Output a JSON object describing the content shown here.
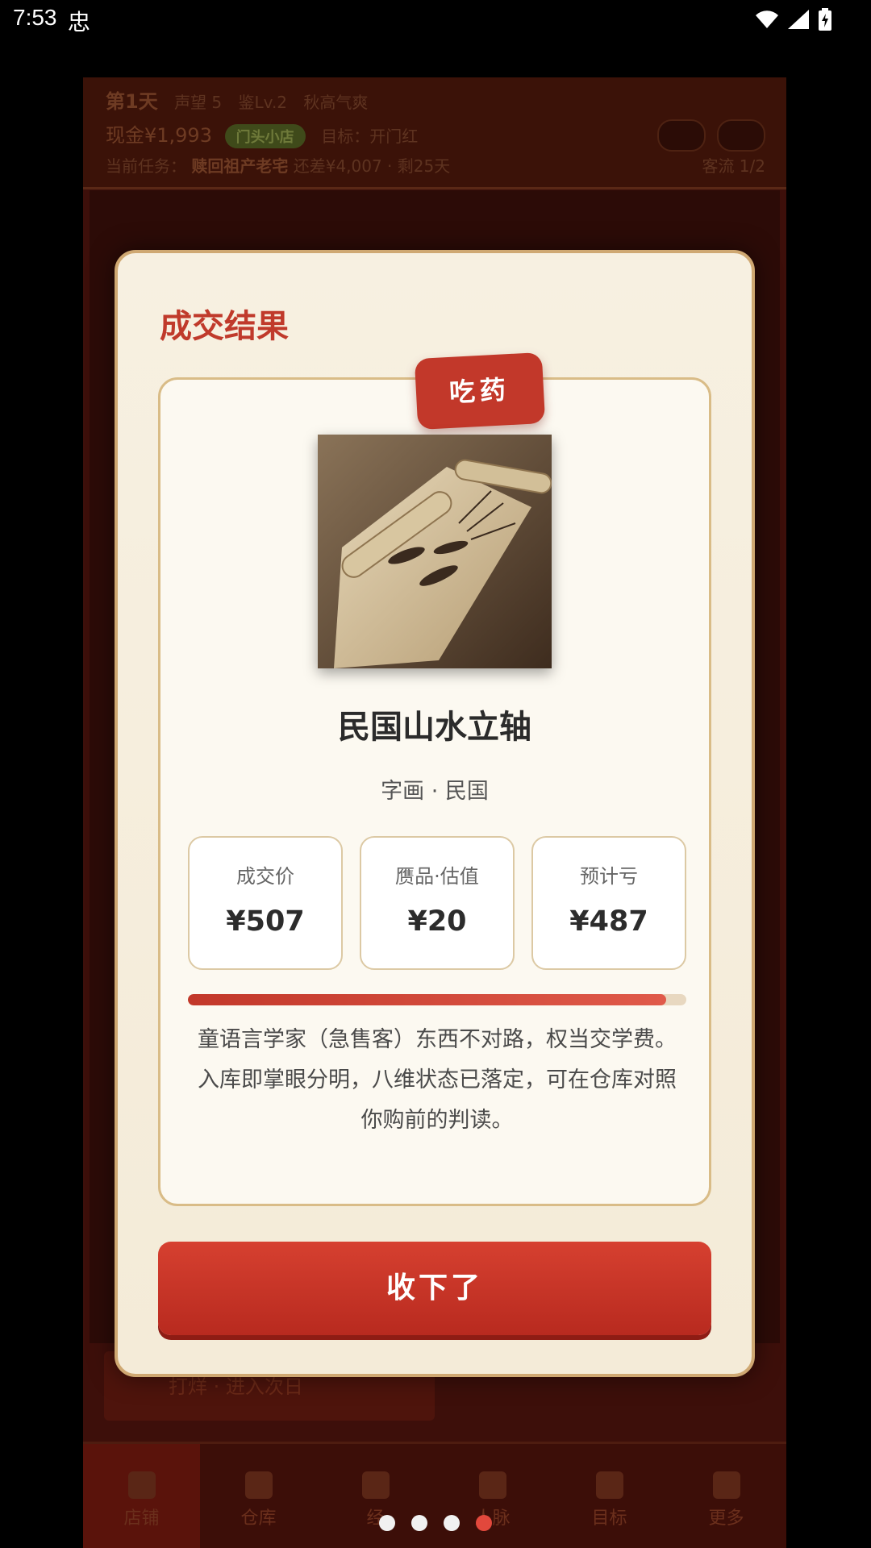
{
  "status_bar": {
    "time": "7:53",
    "bug_glyph": "忠",
    "icons": [
      "wifi-icon",
      "signal-icon",
      "battery-icon"
    ]
  },
  "app_header": {
    "day": "第1天",
    "reputation": "声望 5",
    "appraisal": "鉴Lv.2",
    "weather": "秋高气爽",
    "cash": "现金¥1,993",
    "shop_chip": "门头小店",
    "goal": "目标：开门红",
    "task_prefix": "当前任务：",
    "task_name": "赎回祖产老宅",
    "task_detail": "还差¥4,007 · 剩25天",
    "customer_flow": "客流 1/2"
  },
  "seal_button": {
    "label": "打烊 · 进入次日"
  },
  "bottom_nav": {
    "tabs": [
      {
        "label": "店铺",
        "icon": "shop-icon",
        "active": true
      },
      {
        "label": "仓库",
        "icon": "warehouse-icon",
        "active": false
      },
      {
        "label": "经",
        "icon": "ledger-icon",
        "active": false
      },
      {
        "label": "人脉",
        "icon": "people-icon",
        "active": false
      },
      {
        "label": "目标",
        "icon": "goal-icon",
        "active": false
      },
      {
        "label": "更多",
        "icon": "more-icon",
        "active": false
      }
    ]
  },
  "modal": {
    "title": "成交结果",
    "stamp": "吃药",
    "item": {
      "image": "scroll-painting-shrimp",
      "name": "民国山水立轴",
      "category": "字画 · 民国"
    },
    "stats": [
      {
        "label": "成交价",
        "value": "¥507"
      },
      {
        "label": "赝品·估值",
        "value": "¥20"
      },
      {
        "label": "预计亏",
        "value": "¥487"
      }
    ],
    "loss_ratio": 0.96,
    "description": [
      "童语言学家（急售客）东西不对路，权当交学费。",
      "入库即掌眼分明，八维状态已落定，可在仓库对照你购前的判读。"
    ],
    "confirm_button": "收下了"
  },
  "pager": {
    "count": 4,
    "active_index": 3
  },
  "colors": {
    "accent_red": "#c2382a",
    "card_bg": "#fcf9f1",
    "frame_gold": "#cfa872"
  }
}
